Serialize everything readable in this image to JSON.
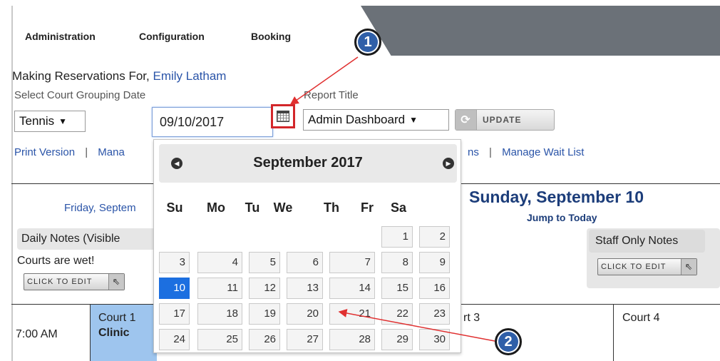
{
  "nav": {
    "items": [
      "Administration",
      "Configuration",
      "Booking"
    ]
  },
  "reservation": {
    "making_for_label": "Making Reservations For,",
    "member_name": "Emily Latham",
    "grouping_label": "Select Court Grouping Date",
    "report_title_label": "Report Title",
    "court_group_value": "Tennis",
    "date_value": "09/10/2017",
    "report_value": "Admin Dashboard",
    "update_label": "UPDATE"
  },
  "links": {
    "print_version": "Print Version",
    "separator": "|",
    "manage_partial": "Mana",
    "ns_partial": "ns",
    "manage_wait_list": "Manage Wait List"
  },
  "schedule": {
    "prev_day": "Friday, Septem",
    "current_day": "Sunday, September 10",
    "jump_today": "Jump to Today",
    "daily_notes_label": "Daily Notes (Visible",
    "daily_notes_text": "Courts are wet!",
    "staff_notes_label": "Staff Only Notes",
    "edit_label": "CLICK TO EDIT",
    "time_slot": "7:00 AM",
    "court1_label": "Court 1",
    "court1_booking": "Clinic",
    "court3_partial": "rt 3",
    "court4_label": "Court 4"
  },
  "calendar": {
    "month_label": "September 2017",
    "weekdays": [
      "Su",
      "Mo",
      "Tu",
      "We",
      "Th",
      "Fr",
      "Sa"
    ],
    "weeks": [
      [
        "",
        "",
        "",
        "",
        "",
        "1",
        "2"
      ],
      [
        "3",
        "4",
        "5",
        "6",
        "7",
        "8",
        "9"
      ],
      [
        "10",
        "11",
        "12",
        "13",
        "14",
        "15",
        "16"
      ],
      [
        "17",
        "18",
        "19",
        "20",
        "21",
        "22",
        "23"
      ],
      [
        "24",
        "25",
        "26",
        "27",
        "28",
        "29",
        "30"
      ]
    ],
    "selected_day": "10"
  },
  "callouts": {
    "first": "1",
    "second": "2"
  },
  "colors": {
    "link": "#2a54a8",
    "selected_day": "#1c6fe0",
    "court_cell": "#9ec5ee",
    "callout": "#2f5fa8",
    "highlight_border": "#d3262a"
  }
}
